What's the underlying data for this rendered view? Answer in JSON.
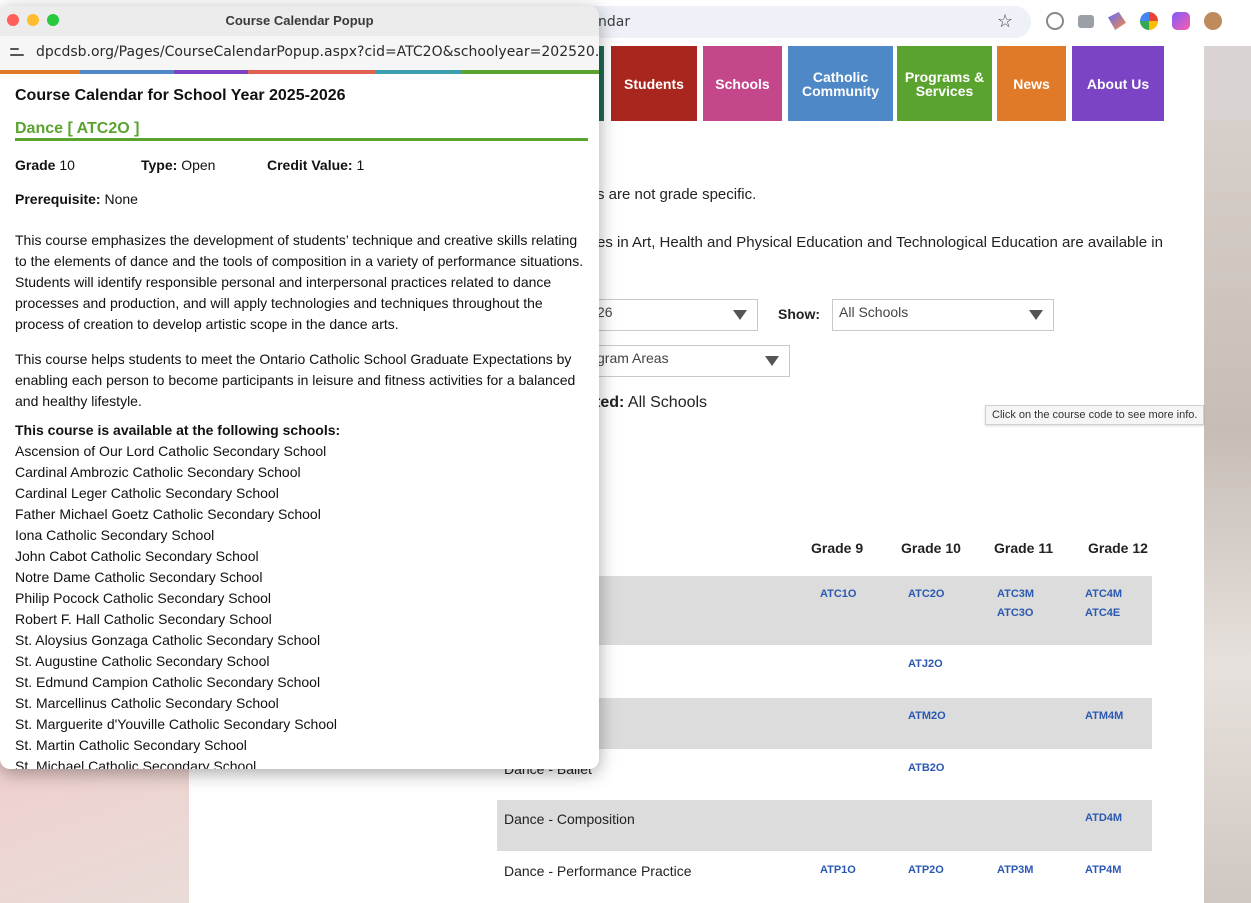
{
  "browser": {
    "address_text": "ndar"
  },
  "nav": {
    "items": [
      {
        "label": "Students",
        "color": "#a8261d"
      },
      {
        "label": "Schools",
        "color": "#c4478c"
      },
      {
        "label": "Catholic Community",
        "color": "#4f88c6"
      },
      {
        "label": "Programs & Services",
        "color": "#5aa32f"
      },
      {
        "label": "News",
        "color": "#e07a28"
      },
      {
        "label": "About Us",
        "color": "#7a44c4"
      }
    ]
  },
  "page": {
    "partial_line1": "s are not grade specific.",
    "partial_line2": "es in Art, Health and Physical Education and Technological Education are available in",
    "year_select_value": "26",
    "show_label": "Show:",
    "show_select_value": "All Schools",
    "program_select_value": "gram Areas",
    "selected_prefix": "ted:",
    "selected_value": "All Schools",
    "tooltip": "Click on the course code to see more info."
  },
  "table": {
    "grades": [
      "Grade 9",
      "Grade 10",
      "Grade 11",
      "Grade 12"
    ],
    "rows": [
      {
        "name": "",
        "shaded": true,
        "codes": [
          [
            "ATC1O"
          ],
          [
            "ATC2O"
          ],
          [
            "ATC3M",
            "ATC3O"
          ],
          [
            "ATC4M",
            "ATC4E"
          ]
        ]
      },
      {
        "name": "",
        "shaded": false,
        "codes": [
          [],
          [
            "ATJ2O"
          ],
          [],
          []
        ]
      },
      {
        "name": "rn",
        "shaded": true,
        "codes": [
          [],
          [
            "ATM2O"
          ],
          [],
          [
            "ATM4M"
          ]
        ]
      },
      {
        "name": "Dance - Ballet",
        "shaded": false,
        "codes": [
          [],
          [
            "ATB2O"
          ],
          [],
          []
        ]
      },
      {
        "name": "Dance - Composition",
        "shaded": true,
        "codes": [
          [],
          [],
          [],
          [
            "ATD4M"
          ]
        ]
      },
      {
        "name": "Dance - Performance Practice",
        "shaded": false,
        "codes": [
          [
            "ATP1O"
          ],
          [
            "ATP2O"
          ],
          [
            "ATP3M"
          ],
          [
            "ATP4M"
          ]
        ]
      }
    ]
  },
  "popup": {
    "window_title": "Course Calendar Popup",
    "url": "dpcdsb.org/Pages/CourseCalendarPopup.aspx?cid=ATC2O&schoolyear=202520...",
    "heading": "Course Calendar for School Year 2025-2026",
    "course_name": "Dance [ ATC2O ]",
    "grade_label": "Grade",
    "grade_value": "10",
    "type_label": "Type:",
    "type_value": "Open",
    "credit_label": "Credit Value:",
    "credit_value": "1",
    "prereq_label": "Prerequisite:",
    "prereq_value": "None",
    "description": "This course emphasizes the development of students’ technique and creative skills relating to the elements of dance and the tools of composition in a variety of performance situations. Students will identify responsible personal and interpersonal practices related to dance processes and production, and will apply technologies and techniques throughout the process of creation to develop artistic scope in the dance arts.",
    "expectations": "This course helps students to meet the Ontario Catholic School Graduate Expectations by enabling each person to become participants in leisure and fitness activities for a balanced and healthy lifestyle.",
    "schools_heading": "This course is available at the following schools:",
    "schools": [
      "Ascension of Our Lord Catholic Secondary School",
      "Cardinal Ambrozic Catholic Secondary School",
      "Cardinal Leger Catholic Secondary School",
      "Father Michael Goetz Catholic Secondary School",
      "Iona Catholic Secondary School",
      "John Cabot Catholic Secondary School",
      "Notre Dame Catholic Secondary School",
      "Philip Pocock Catholic Secondary School",
      "Robert F. Hall Catholic Secondary School",
      "St. Aloysius Gonzaga Catholic Secondary School",
      "St. Augustine Catholic Secondary School",
      "St. Edmund Campion Catholic Secondary School",
      "St. Marcellinus Catholic Secondary School",
      "St. Marguerite d'Youville Catholic Secondary School",
      "St. Martin Catholic Secondary School",
      "St. Michael Catholic Secondary School"
    ],
    "stripe_colors": [
      "#e07a28",
      "#4f88c6",
      "#7a44c4",
      "#e06050",
      "#3aa0b0",
      "#5aa32f"
    ]
  }
}
